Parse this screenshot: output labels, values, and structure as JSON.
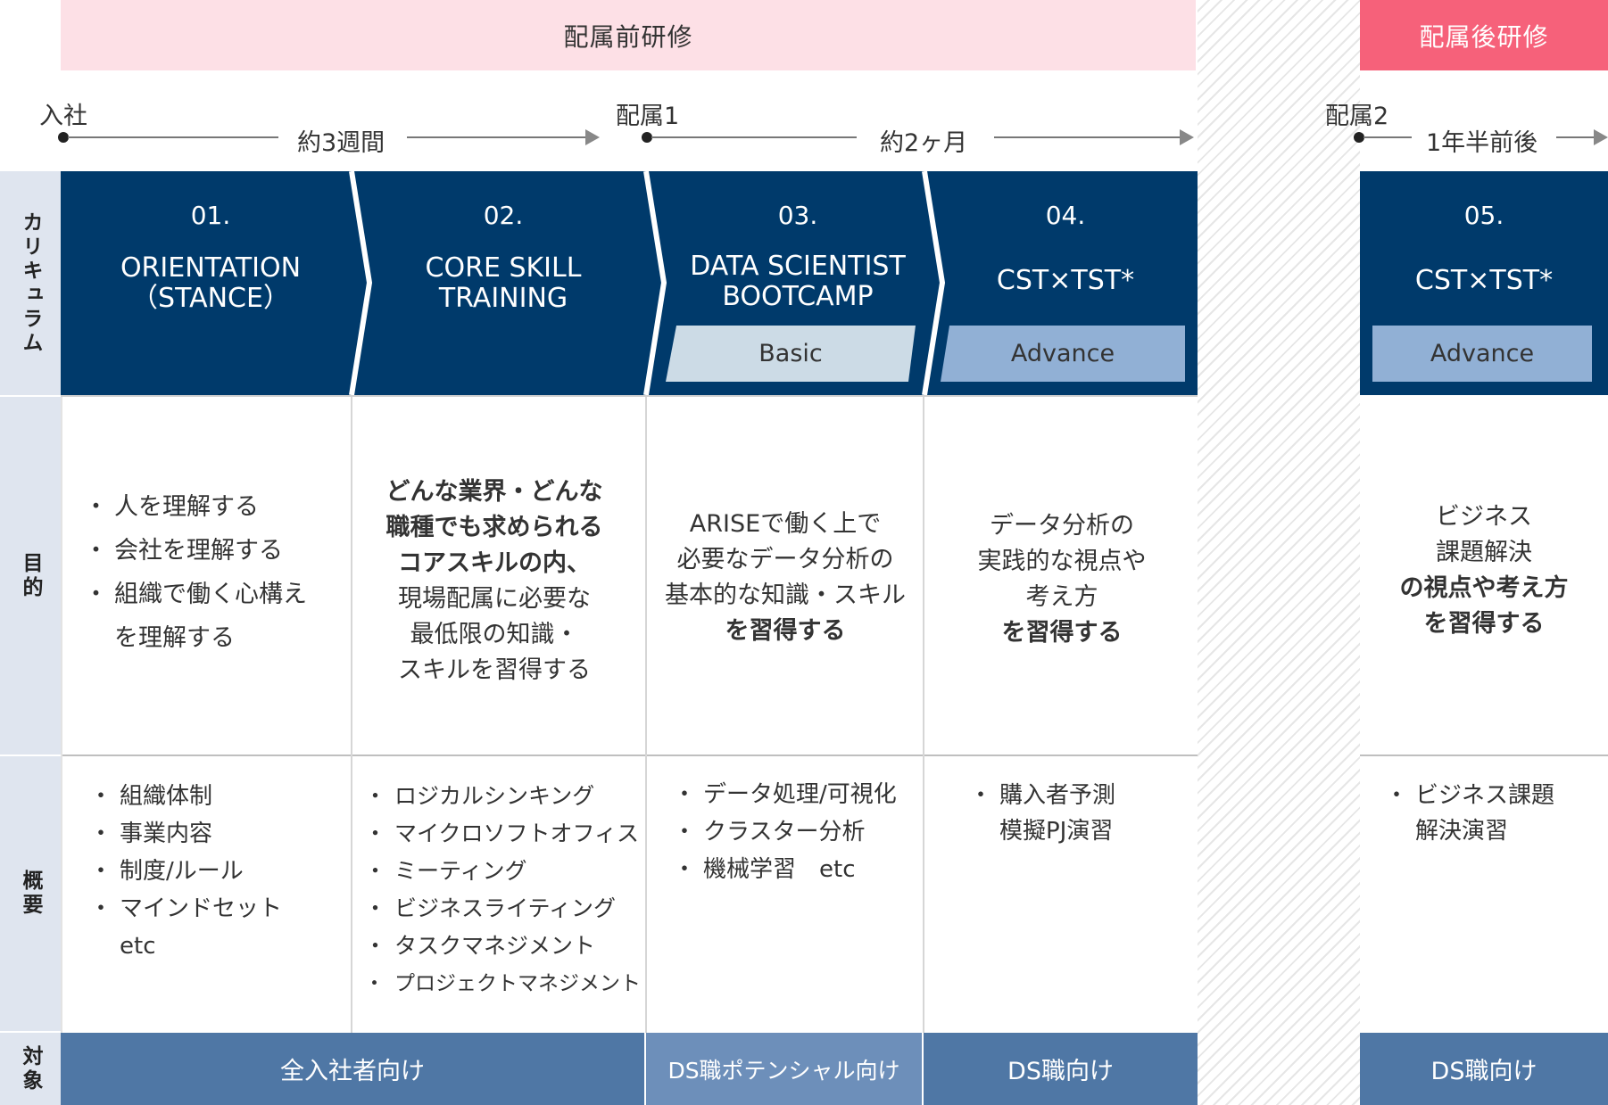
{
  "phases": {
    "pre": "配属前研修",
    "post": "配属後研修"
  },
  "timeline": {
    "start": "入社",
    "dur1": "約3週間",
    "assign1": "配属1",
    "dur2": "約2ヶ月",
    "assign2": "配属2",
    "dur3": "1年半前後"
  },
  "row_labels": {
    "curriculum": "カリキュラム",
    "purpose": "目的",
    "overview": "概要",
    "target": "対象"
  },
  "curriculum": [
    {
      "num": "01.",
      "title_1": "ORIENTATION",
      "title_2": "（STANCE）"
    },
    {
      "num": "02.",
      "title_1": "CORE SKILL",
      "title_2": "TRAINING"
    },
    {
      "num": "03.",
      "title_1": "DATA SCIENTIST",
      "title_2": "BOOTCAMP",
      "badge": "Basic"
    },
    {
      "num": "04.",
      "title_1": "CST×TST*",
      "badge": "Advance"
    },
    {
      "num": "05.",
      "title_1": "CST×TST*",
      "badge": "Advance"
    }
  ],
  "purpose": {
    "c1": [
      "人を理解する",
      "会社を理解する",
      "組織で働く心構え",
      "を理解する"
    ],
    "c2": [
      "どんな業界・どんな",
      "職種でも求められる",
      "コアスキルの内、",
      "現場配属に必要な",
      "最低限の知識・",
      "スキルを習得する"
    ],
    "c3": [
      "ARISEで働く上で",
      "必要なデータ分析の",
      "基本的な知識・スキル",
      "を習得する"
    ],
    "c4": [
      "データ分析の",
      "実践的な視点や",
      "考え方",
      "を習得する"
    ],
    "c5": [
      "ビジネス",
      "課題解決",
      "の視点や考え方",
      "を習得する"
    ]
  },
  "overview": {
    "c1": [
      "組織体制",
      "事業内容",
      "制度/ルール",
      "マインドセット",
      "etc"
    ],
    "c2": [
      "ロジカルシンキング",
      "マイクロソフトオフィス",
      "ミーティング",
      "ビジネスライティング",
      "タスクマネジメント",
      "プロジェクトマネジメント"
    ],
    "c3": [
      "データ処理/可視化",
      "クラスター分析",
      "機械学習　etc"
    ],
    "c4": [
      "購入者予測",
      "模擬PJ演習"
    ],
    "c5": [
      "ビジネス課題",
      "解決演習"
    ]
  },
  "target": {
    "all": "全入社者向け",
    "ds_potential": "DS職ポテンシャル向け",
    "ds": "DS職向け",
    "ds_post": "DS職向け"
  },
  "colors": {
    "navy": "#003a6b",
    "pink_light": "#fde0e6",
    "pink": "#f6617a",
    "target_blue": "#4f77a5",
    "target_blue_light": "#6d8fba",
    "badge_basic": "#ccdbe6",
    "badge_advance": "#91b0d5"
  }
}
